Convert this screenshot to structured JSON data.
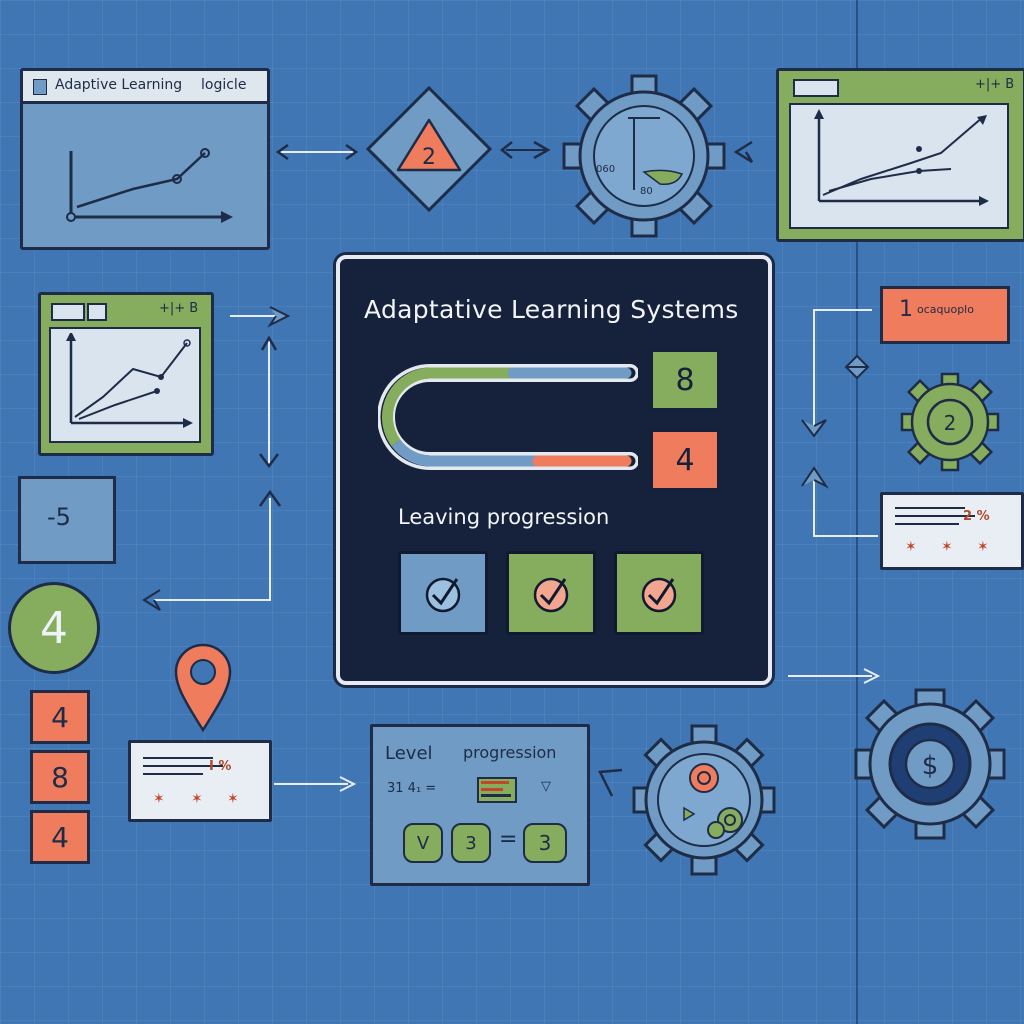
{
  "top_left_window": {
    "title": "Adaptive Learning",
    "title_right": "logicle"
  },
  "top_diamond": {
    "value": "2"
  },
  "top_gear": {
    "left_text": "060",
    "bottom_text": "80"
  },
  "top_right_window": {
    "corner": "+|+ B"
  },
  "mid_left_window": {
    "corner": "+|+ B"
  },
  "small_box": {
    "value": "-5"
  },
  "circle_four": {
    "value": "4"
  },
  "orange_stack": [
    "4",
    "8",
    "4"
  ],
  "center_panel": {
    "title": "Adaptative Learning Systems",
    "box_top": "8",
    "box_bottom": "4",
    "subtitle": "Leaving progression"
  },
  "right_orange_label": {
    "number": "1",
    "text": "ocaquoplo"
  },
  "right_gear_badge": {
    "value": "2"
  },
  "right_card": {
    "text": "2 %"
  },
  "left_card": {
    "text": "I %"
  },
  "level_card": {
    "title_left": "Level",
    "title_right": "progression",
    "formula": "31 4₁ =",
    "badge_left": "V",
    "badge_mid": "3",
    "equals": "=",
    "badge_right": "3"
  },
  "bottom_right_gear": {
    "value": "$"
  },
  "colors": {
    "background": "#3f76b3",
    "navy": "#16223b",
    "green": "#86ac5e",
    "orange": "#f07c5e",
    "light_blue": "#6f9bc4",
    "paper": "#e9eef4"
  }
}
